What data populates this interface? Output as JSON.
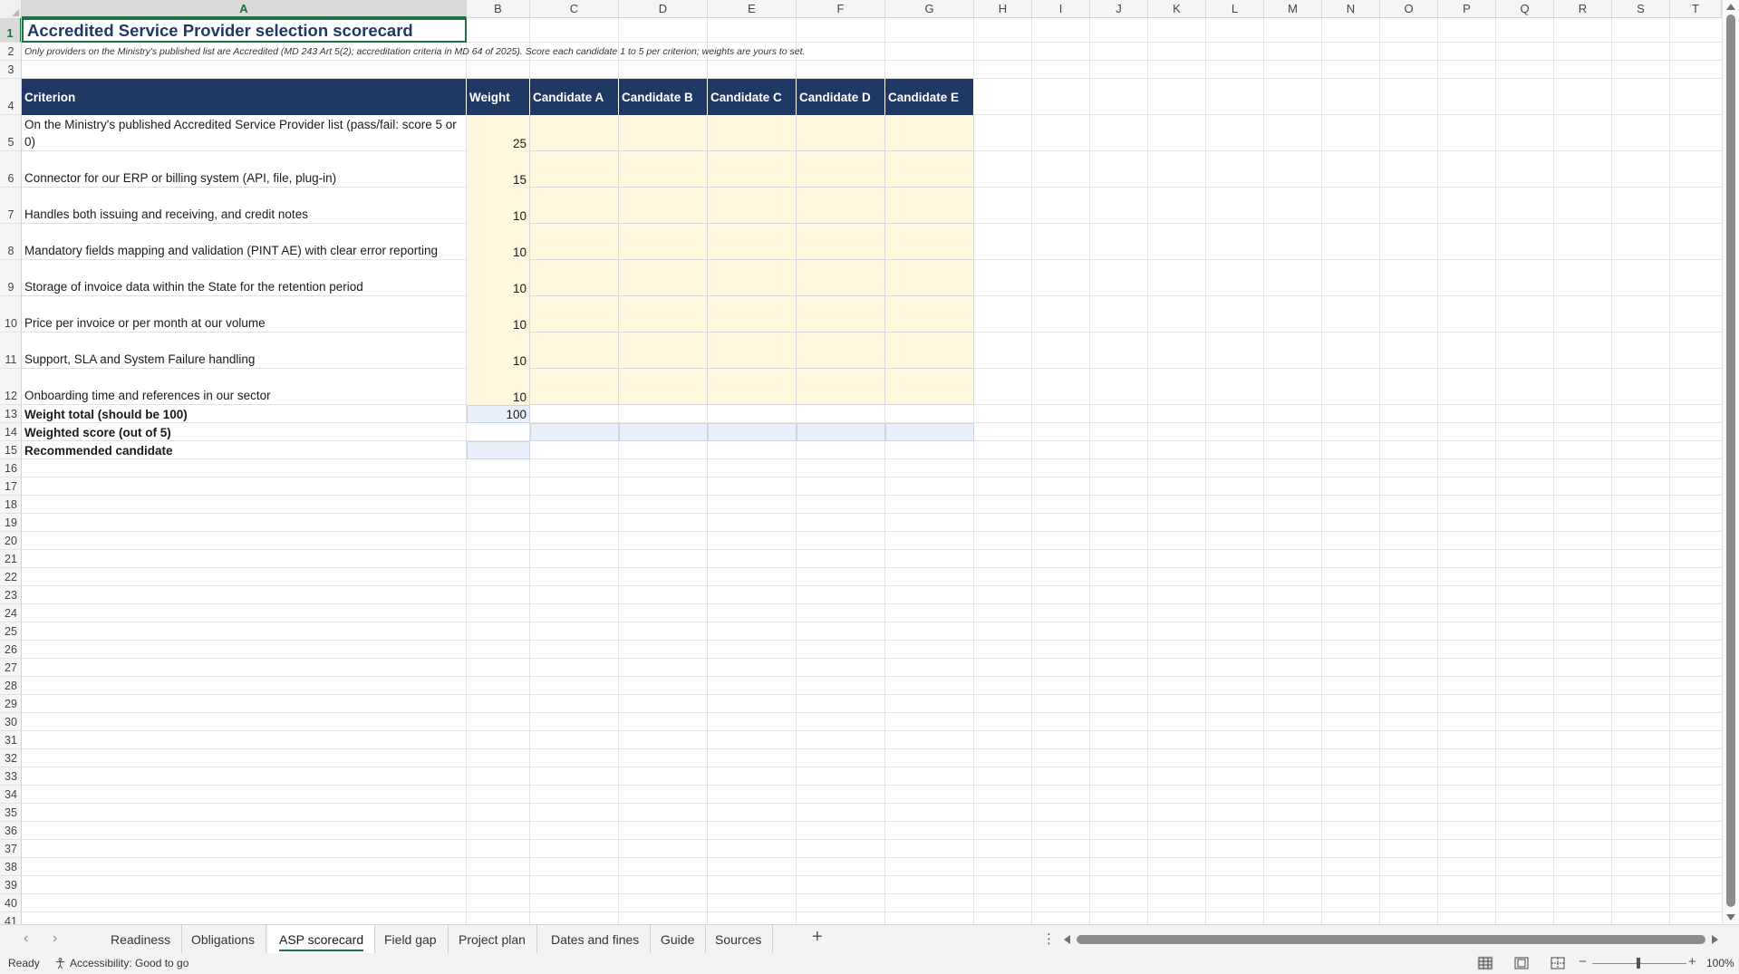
{
  "columns": [
    "A",
    "B",
    "C",
    "D",
    "E",
    "F",
    "G",
    "H",
    "I",
    "J",
    "K",
    "L",
    "M",
    "N",
    "O",
    "P",
    "Q",
    "R",
    "S",
    "T"
  ],
  "active_column": "A",
  "rows": [
    "1",
    "2",
    "3",
    "4",
    "5",
    "6",
    "7",
    "8",
    "9",
    "10",
    "11",
    "12",
    "13",
    "14",
    "15",
    "16",
    "17",
    "18",
    "19",
    "20",
    "21",
    "22",
    "23",
    "24",
    "25",
    "26",
    "27",
    "28",
    "29",
    "30",
    "31",
    "32",
    "33",
    "34",
    "35",
    "36",
    "37",
    "38",
    "39",
    "40",
    "41"
  ],
  "active_row": "1",
  "sheet": {
    "title": "Accredited Service Provider selection scorecard",
    "note": "Only providers on the Ministry's published list are Accredited (MD 243 Art 5(2); accreditation criteria in MD 64 of 2025). Score each candidate 1 to 5 per criterion; weights are yours to set.",
    "header": {
      "criterion": "Criterion",
      "weight": "Weight",
      "candidates": [
        "Candidate A",
        "Candidate B",
        "Candidate C",
        "Candidate D",
        "Candidate E"
      ]
    },
    "criteria": [
      {
        "label": "On the Ministry's published Accredited Service Provider list (pass/fail: score 5 or 0)",
        "weight": "25"
      },
      {
        "label": "Connector for our ERP or billing system (API, file, plug-in)",
        "weight": "15"
      },
      {
        "label": "Handles both issuing and receiving, and credit notes",
        "weight": "10"
      },
      {
        "label": "Mandatory fields mapping and validation (PINT AE) with clear error reporting",
        "weight": "10"
      },
      {
        "label": "Storage of invoice data within the State for the retention period",
        "weight": "10"
      },
      {
        "label": "Price per invoice or per month at our volume",
        "weight": "10"
      },
      {
        "label": "Support, SLA and System Failure handling",
        "weight": "10"
      },
      {
        "label": "Onboarding time and references in our sector",
        "weight": "10"
      }
    ],
    "weight_total_label": "Weight total (should be 100)",
    "weight_total_value": "100",
    "weighted_score_label": "Weighted score (out of 5)",
    "recommended_label": "Recommended candidate"
  },
  "tabs": {
    "items": [
      "Readiness",
      "Obligations",
      "ASP scorecard",
      "Field gap",
      "Project plan",
      "Dates and fines",
      "Guide",
      "Sources"
    ],
    "active": "ASP scorecard",
    "add": "+"
  },
  "status": {
    "ready": "Ready",
    "accessibility": "Accessibility: Good to go",
    "zoom": "100%"
  },
  "colors": {
    "header_fill": "#1f3864",
    "input_fill": "#fff7de",
    "output_fill": "#e9f0fb",
    "accent": "#1e7145"
  },
  "icons": [
    "accessibility-icon",
    "normal-view-icon",
    "page-layout-view-icon",
    "page-break-view-icon",
    "zoom-minus-icon",
    "zoom-plus-icon",
    "add-sheet-icon",
    "scroll-left-icon",
    "scroll-right-icon"
  ]
}
